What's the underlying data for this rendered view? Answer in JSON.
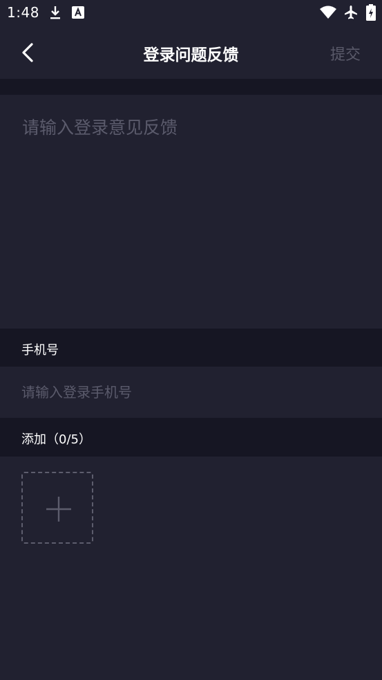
{
  "status_bar": {
    "time": "1:48",
    "icons": [
      "download-icon",
      "font-a-icon",
      "wifi-icon",
      "airplane-icon",
      "battery-charging-icon"
    ]
  },
  "header": {
    "title": "登录问题反馈",
    "back_icon": "chevron-left-icon",
    "submit_label": "提交"
  },
  "feedback": {
    "placeholder": "请输入登录意见反馈",
    "value": ""
  },
  "phone_section": {
    "label": "手机号",
    "placeholder": "请输入登录手机号",
    "value": ""
  },
  "attachments": {
    "label": "添加（0/5）",
    "add_icon": "plus-icon"
  },
  "colors": {
    "background": "#212130",
    "section_band": "#161623",
    "placeholder": "#5b5b6c",
    "submit_disabled": "#5a5a6a"
  }
}
